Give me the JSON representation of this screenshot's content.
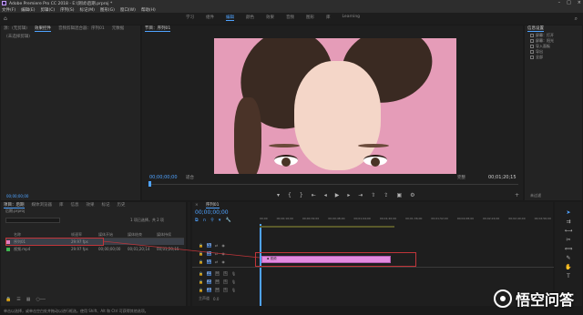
{
  "window": {
    "title": "Adobe Premiere Pro CC 2018 - E:\\测试\\后期.prproj *"
  },
  "menu": [
    "文件(F)",
    "编辑(E)",
    "剪辑(C)",
    "序列(S)",
    "标记(M)",
    "图形(G)",
    "窗口(W)",
    "帮助(H)"
  ],
  "workspaces": [
    "学习",
    "组件",
    "编辑",
    "颜色",
    "效果",
    "音频",
    "图形",
    "库",
    "Learning"
  ],
  "active_workspace": "编辑",
  "source_panel": {
    "tabs": [
      "源：(无剪辑)",
      "效果控件",
      "音频剪辑混合器：序列01",
      "元数据"
    ],
    "empty_text": "(未选择剪辑)",
    "bottom_time": "00;00;00;00"
  },
  "program_monitor": {
    "tab": "节目：序列01",
    "timecode": "00;00;00;00",
    "fit": "适合",
    "quality": "完整",
    "duration": "00;01;20;15"
  },
  "right_panel": {
    "title": "信息设置",
    "items": [
      "屏幕：打开",
      "屏幕：阳光",
      "导入面板",
      "导出",
      "全部"
    ],
    "bottom_text": "未过滤"
  },
  "project_panel": {
    "tabs": [
      "项目：后期",
      "媒体浏览器",
      "库",
      "信息",
      "效果",
      "标记",
      "历史"
    ],
    "path": "后期.prproj",
    "count_label": "1 项已选择，共 2 项",
    "columns": [
      "名称",
      "帧速率",
      "媒体开始",
      "媒体结束",
      "媒体持续"
    ],
    "rows": [
      {
        "name": "序列01",
        "fps": "29.97 fps",
        "start": "",
        "end": "",
        "dur": "",
        "color": "#e37cc0"
      },
      {
        "name": "视频.mp4",
        "fps": "29.97 fps",
        "start": "00;00;00;00",
        "end": "00;01;20;14",
        "dur": "00;01;20;15",
        "color": "#3fb34f"
      }
    ]
  },
  "timeline": {
    "tab": "序列01",
    "timecode": "00;00;00;00",
    "ruler": [
      "00;00",
      "00;00;16;00",
      "00;00;32;00",
      "00;00;48;00",
      "00;01;04;00",
      "00;01;20;00",
      "00;01;36;00",
      "00;01;52;00",
      "00;02;08;00",
      "00;02;24;00",
      "00;02;40;00",
      "00;02;56;00"
    ],
    "video_tracks": [
      "V3",
      "V2",
      "V1"
    ],
    "audio_tracks": [
      "A1",
      "A2",
      "A3"
    ],
    "clip_label": "视频",
    "mix_label": "主声道",
    "mix_value": "0.0"
  },
  "status": "单击以选择，或单击空白处并拖动以进行框选。使用 Shift、Alt 和 Ctrl 可获得其他选项。",
  "watermark": "悟空问答"
}
